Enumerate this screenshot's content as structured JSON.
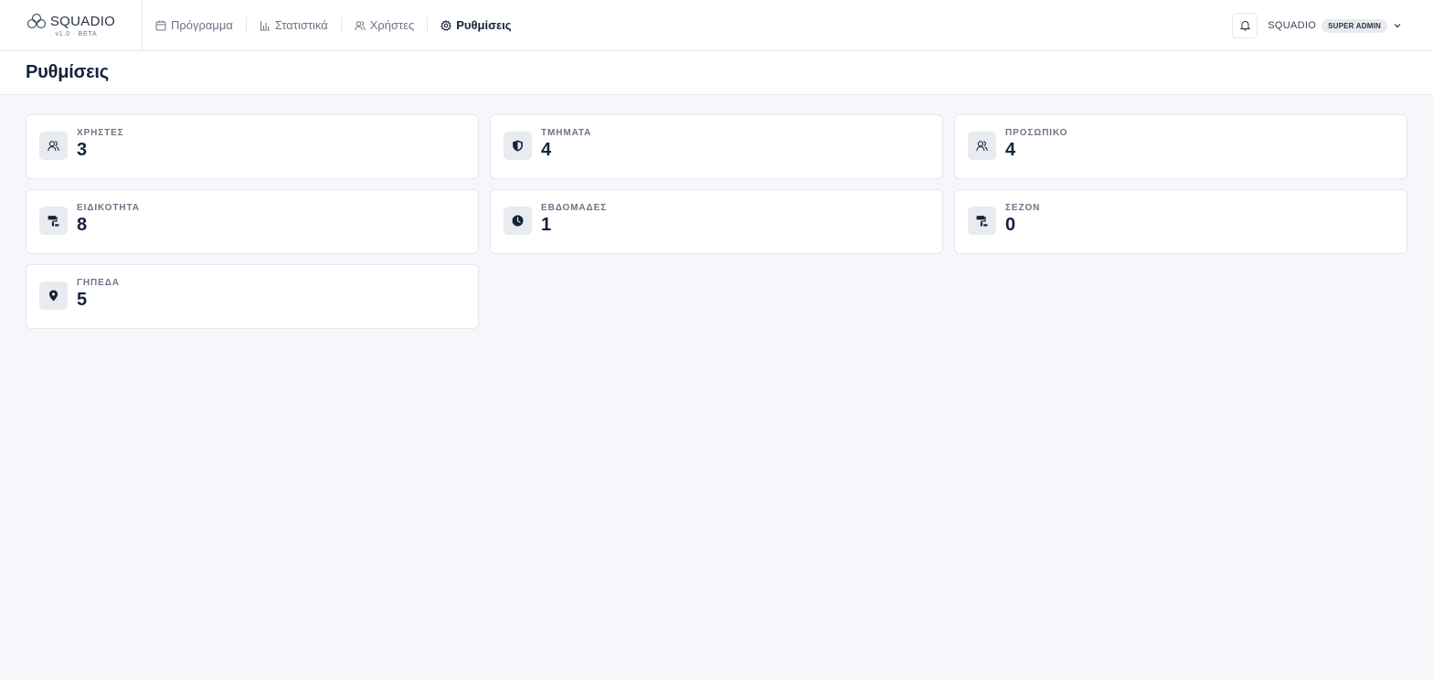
{
  "brand": {
    "name": "SQUADIO",
    "version": "v1.0 · BETA",
    "logo_icon": "trefoil-logo-icon"
  },
  "nav": {
    "items": [
      {
        "label": "Πρόγραμμα",
        "icon": "calendar-icon",
        "active": false
      },
      {
        "label": "Στατιστικά",
        "icon": "bar-chart-icon",
        "active": false
      },
      {
        "label": "Χρήστες",
        "icon": "users-icon",
        "active": false
      },
      {
        "label": "Ρυθμίσεις",
        "icon": "gear-icon",
        "active": true
      }
    ]
  },
  "header": {
    "user_name": "SQUADIO",
    "role_badge": "SUPER ADMIN",
    "bell_icon": "bell-icon",
    "menu_icon": "chevron-down-icon"
  },
  "page": {
    "title": "Ρυθμίσεις"
  },
  "cards": [
    {
      "label": "ΧΡΗΣΤΕΣ",
      "value": "3",
      "icon": "users-icon"
    },
    {
      "label": "ΤΜΗΜΑΤΑ",
      "value": "4",
      "icon": "shield-icon"
    },
    {
      "label": "ΠΡΟΣΩΠΙΚΟ",
      "value": "4",
      "icon": "users-icon"
    },
    {
      "label": "ΕΙΔΙΚΟΤΗΤΑ",
      "value": "8",
      "icon": "paint-roller-icon"
    },
    {
      "label": "ΕΒΔΟΜΑΔΕΣ",
      "value": "1",
      "icon": "clock-icon"
    },
    {
      "label": "ΣΕΖΟΝ",
      "value": "0",
      "icon": "paint-roller-icon"
    },
    {
      "label": "ΓΗΠΕΔΑ",
      "value": "5",
      "icon": "map-pin-icon"
    }
  ],
  "colors": {
    "text_dark": "#14233b",
    "text_muted": "#6b7585",
    "background": "#f5f7fa",
    "card_icon_bg": "#e8ebef"
  }
}
